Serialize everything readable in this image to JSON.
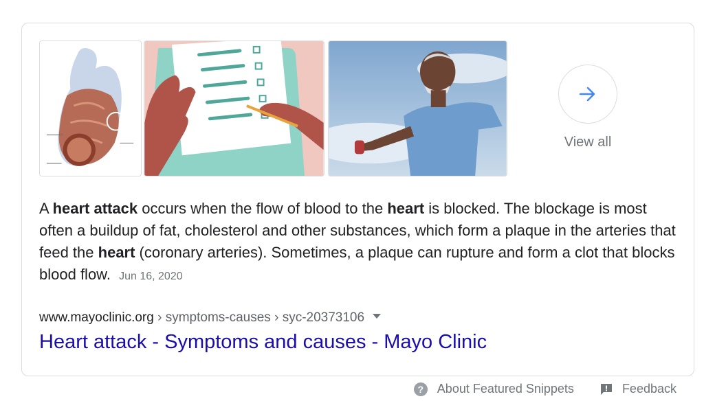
{
  "images": [
    {
      "name": "heart-anatomy-illustration"
    },
    {
      "name": "checklist-illustration"
    },
    {
      "name": "man-stretching-photo"
    }
  ],
  "view_all": {
    "label": "View all",
    "icon": "arrow-right-icon",
    "accent": "#4285f4"
  },
  "snippet": {
    "parts": [
      "A ",
      "heart attack",
      " occurs when the flow of blood to the ",
      "heart",
      " is blocked. The blockage is most often a buildup of fat, cholesterol and other substances, which form a plaque in the arteries that feed the ",
      "heart",
      " (coronary arteries). Sometimes, a plaque can rupture and form a clot that blocks blood flow."
    ],
    "date": "Jun 16, 2020"
  },
  "source": {
    "domain": "www.mayoclinic.org",
    "breadcrumb": " › symptoms-causes › syc-20373106",
    "title": "Heart attack - Symptoms and causes - Mayo Clinic",
    "link_color": "#1a0dab"
  },
  "footer": {
    "about": "About Featured Snippets",
    "feedback": "Feedback"
  }
}
